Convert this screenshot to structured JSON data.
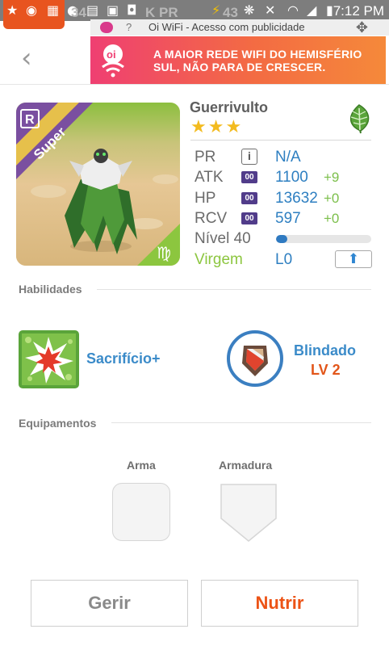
{
  "status_bar": {
    "faded_left": "34",
    "faded_mid": "K PR",
    "faded_right": "43",
    "time": "7:12 PM"
  },
  "wifi_banner": {
    "question": "?",
    "text": "Oi WiFi - Acesso com publicidade",
    "ad_text": "A MAIOR REDE WIFI DO HEMISFÉRIO SUL, NÃO PARA DE CRESCER."
  },
  "header": {
    "back_icon": "chevron-left-icon"
  },
  "monster": {
    "name": "Guerrivulto",
    "rank_badge": "R",
    "tier_ribbon": "Super",
    "stars": 3,
    "element": "leaf-icon",
    "stats": {
      "pr_label": "PR",
      "pr_value": "N/A",
      "atk_label": "ATK",
      "atk_value": "1100",
      "atk_bonus": "+9",
      "hp_label": "HP",
      "hp_value": "13632",
      "hp_bonus": "+0",
      "rcv_label": "RCV",
      "rcv_value": "597",
      "rcv_bonus": "+0",
      "level_text": "Nível 40",
      "level_progress": 0.12,
      "zodiac": "Virgem",
      "l_value": "L0",
      "chip_text": "00"
    }
  },
  "skills": {
    "title": "Habilidades",
    "active_name": "Sacrifício+",
    "passive_name": "Blindado",
    "passive_level": "LV 2"
  },
  "equipment": {
    "title": "Equipamentos",
    "weapon_label": "Arma",
    "armor_label": "Armadura"
  },
  "buttons": {
    "gerir": "Gerir",
    "nutrir": "Nutrir"
  },
  "colors": {
    "accent_blue": "#2e7fc1",
    "accent_orange": "#ec5316",
    "bonus_green": "#7cbf4b",
    "zodiac_green": "#8cc63f"
  }
}
